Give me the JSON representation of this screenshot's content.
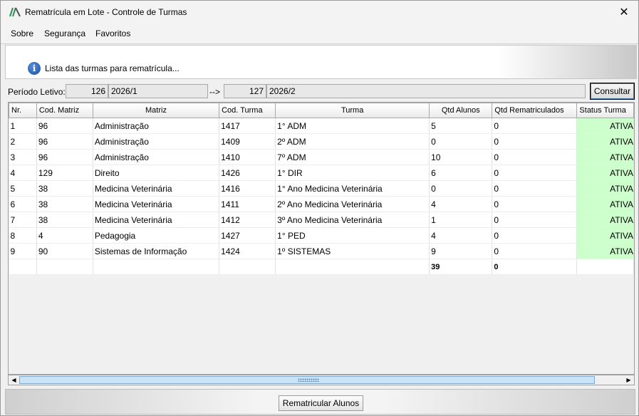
{
  "window": {
    "title": "Rematrícula em Lote - Controle de Turmas",
    "close_glyph": "✕"
  },
  "menu": {
    "items": [
      "Sobre",
      "Segurança",
      "Favoritos"
    ]
  },
  "banner": {
    "text": "Lista das turmas para rematrícula...",
    "icon": "info-icon"
  },
  "periodo": {
    "label": "Período Letivo:",
    "from_code": "126",
    "from_name": "2026/1",
    "arrow": "-->",
    "to_code": "127",
    "to_name": "2026/2",
    "button": "Consultar"
  },
  "table": {
    "columns": [
      "Nr.",
      "Cod. Matriz",
      "Matriz",
      "Cod. Turma",
      "Turma",
      "Qtd Alunos",
      "Qtd Rematriculados",
      "Status Turma"
    ],
    "rows": [
      [
        "1",
        "96",
        "Administração",
        "1417",
        "1° ADM",
        "5",
        "0",
        "ATIVA"
      ],
      [
        "2",
        "96",
        "Administração",
        "1409",
        "2º ADM",
        "0",
        "0",
        "ATIVA"
      ],
      [
        "3",
        "96",
        "Administração",
        "1410",
        "7º ADM",
        "10",
        "0",
        "ATIVA"
      ],
      [
        "4",
        "129",
        "Direito",
        "1426",
        "1° DIR",
        "6",
        "0",
        "ATIVA"
      ],
      [
        "5",
        "38",
        "Medicina Veterinária",
        "1416",
        "1°  Ano Medicina Veterinária",
        "0",
        "0",
        "ATIVA"
      ],
      [
        "6",
        "38",
        "Medicina Veterinária",
        "1411",
        "2º Ano Medicina Veterinária",
        "4",
        "0",
        "ATIVA"
      ],
      [
        "7",
        "38",
        "Medicina Veterinária",
        "1412",
        "3º Ano Medicina Veterinária",
        "1",
        "0",
        "ATIVA"
      ],
      [
        "8",
        "4",
        "Pedagogia",
        "1427",
        "1° PED",
        "4",
        "0",
        "ATIVA"
      ],
      [
        "9",
        "90",
        "Sistemas de Informação",
        "1424",
        "1º SISTEMAS",
        "9",
        "0",
        "ATIVA"
      ]
    ],
    "totals": {
      "qtd_alunos": "39",
      "qtd_rematriculados": "0"
    },
    "status_color": "#ccffcc"
  },
  "scrollbar": {
    "left": "◀",
    "right": "▶"
  },
  "footer": {
    "button": "Rematricular Alunos"
  }
}
